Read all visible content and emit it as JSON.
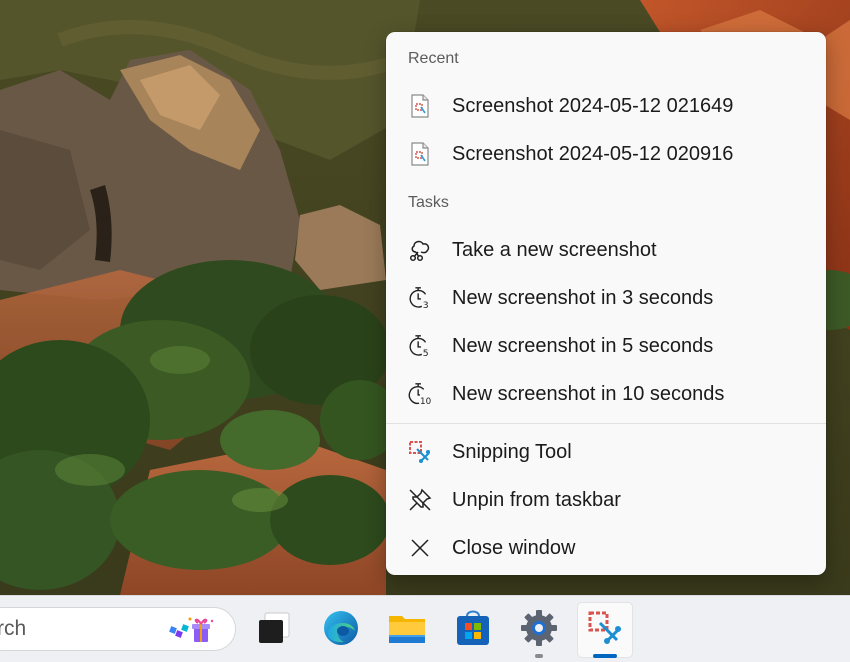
{
  "jumplist": {
    "recent_header": "Recent",
    "recent_items": [
      {
        "label": "Screenshot 2024-05-12 021649",
        "icon": "image-file-icon"
      },
      {
        "label": "Screenshot 2024-05-12 020916",
        "icon": "image-file-icon"
      }
    ],
    "tasks_header": "Tasks",
    "task_items": [
      {
        "label": "Take a new screenshot",
        "icon": "snip-icon"
      },
      {
        "label": "New screenshot in 3 seconds",
        "icon": "timer-3-icon",
        "badge": "3"
      },
      {
        "label": "New screenshot in 5 seconds",
        "icon": "timer-5-icon",
        "badge": "5"
      },
      {
        "label": "New screenshot in 10 seconds",
        "icon": "timer-10-icon",
        "badge": "10"
      }
    ],
    "app_items": [
      {
        "label": "Snipping Tool",
        "icon": "snipping-tool-icon"
      },
      {
        "label": "Unpin from taskbar",
        "icon": "unpin-icon"
      },
      {
        "label": "Close window",
        "icon": "close-icon"
      }
    ]
  },
  "taskbar": {
    "search_text": "rch",
    "apps": [
      {
        "name": "task-view",
        "icon": "task-view-icon"
      },
      {
        "name": "edge",
        "icon": "edge-icon"
      },
      {
        "name": "file-explorer",
        "icon": "folder-icon"
      },
      {
        "name": "microsoft-store",
        "icon": "store-icon"
      },
      {
        "name": "settings",
        "icon": "gear-icon",
        "running": true
      },
      {
        "name": "snipping-tool",
        "icon": "snipping-tool-icon",
        "active": true
      }
    ]
  },
  "colors": {
    "menu_bg": "#f9f9f9",
    "taskbar_bg": "#eef0f3",
    "text": "#1b1b1b",
    "accent": "#0067c0"
  }
}
